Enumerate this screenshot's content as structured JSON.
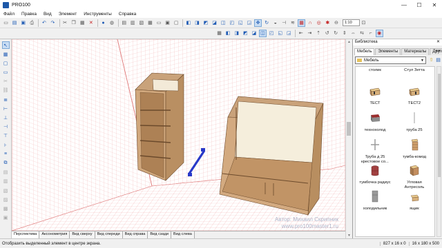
{
  "window": {
    "title": "PRO100",
    "controls": [
      "—",
      "☐",
      "✕"
    ]
  },
  "menu": [
    "Файл",
    "Правка",
    "Вид",
    "Элемент",
    "Инструменты",
    "Справка"
  ],
  "toolbar": {
    "zoom_value": "1:10"
  },
  "view_tabs": [
    "Перспектива",
    "Аксонометрия",
    "Вид сверху",
    "Вид спереди",
    "Вид справа",
    "Вид сзади",
    "Вид слева"
  ],
  "library": {
    "title": "Библиотека",
    "close": "✕",
    "tabs": [
      "Мебель",
      "Элементы",
      "Материалы",
      "Другое"
    ],
    "tab_nav": "◂ ▸",
    "folder": "Мебель",
    "items": [
      {
        "label": "столик"
      },
      {
        "label": "Стул Зетта"
      },
      {
        "label": "ТЕСТ"
      },
      {
        "label": "ТЕСТ2"
      },
      {
        "label": "технохолод"
      },
      {
        "label": "труба 25"
      },
      {
        "label": "Труба д 25 крестовое со..."
      },
      {
        "label": "тумба-комод"
      },
      {
        "label": "тумбочка радиус"
      },
      {
        "label": "Угловая Антресоль"
      },
      {
        "label": "холодильник"
      },
      {
        "label": "ящик"
      }
    ]
  },
  "watermark": {
    "line1": "Автор: Михаил Скрипник",
    "line2": "www.pro100master1.ru"
  },
  "status": {
    "message": "Отобразить выделенный элемент в центре экрана.",
    "dims1": "827 x 16 x 0",
    "dims2": "16 x 180 x 500"
  }
}
